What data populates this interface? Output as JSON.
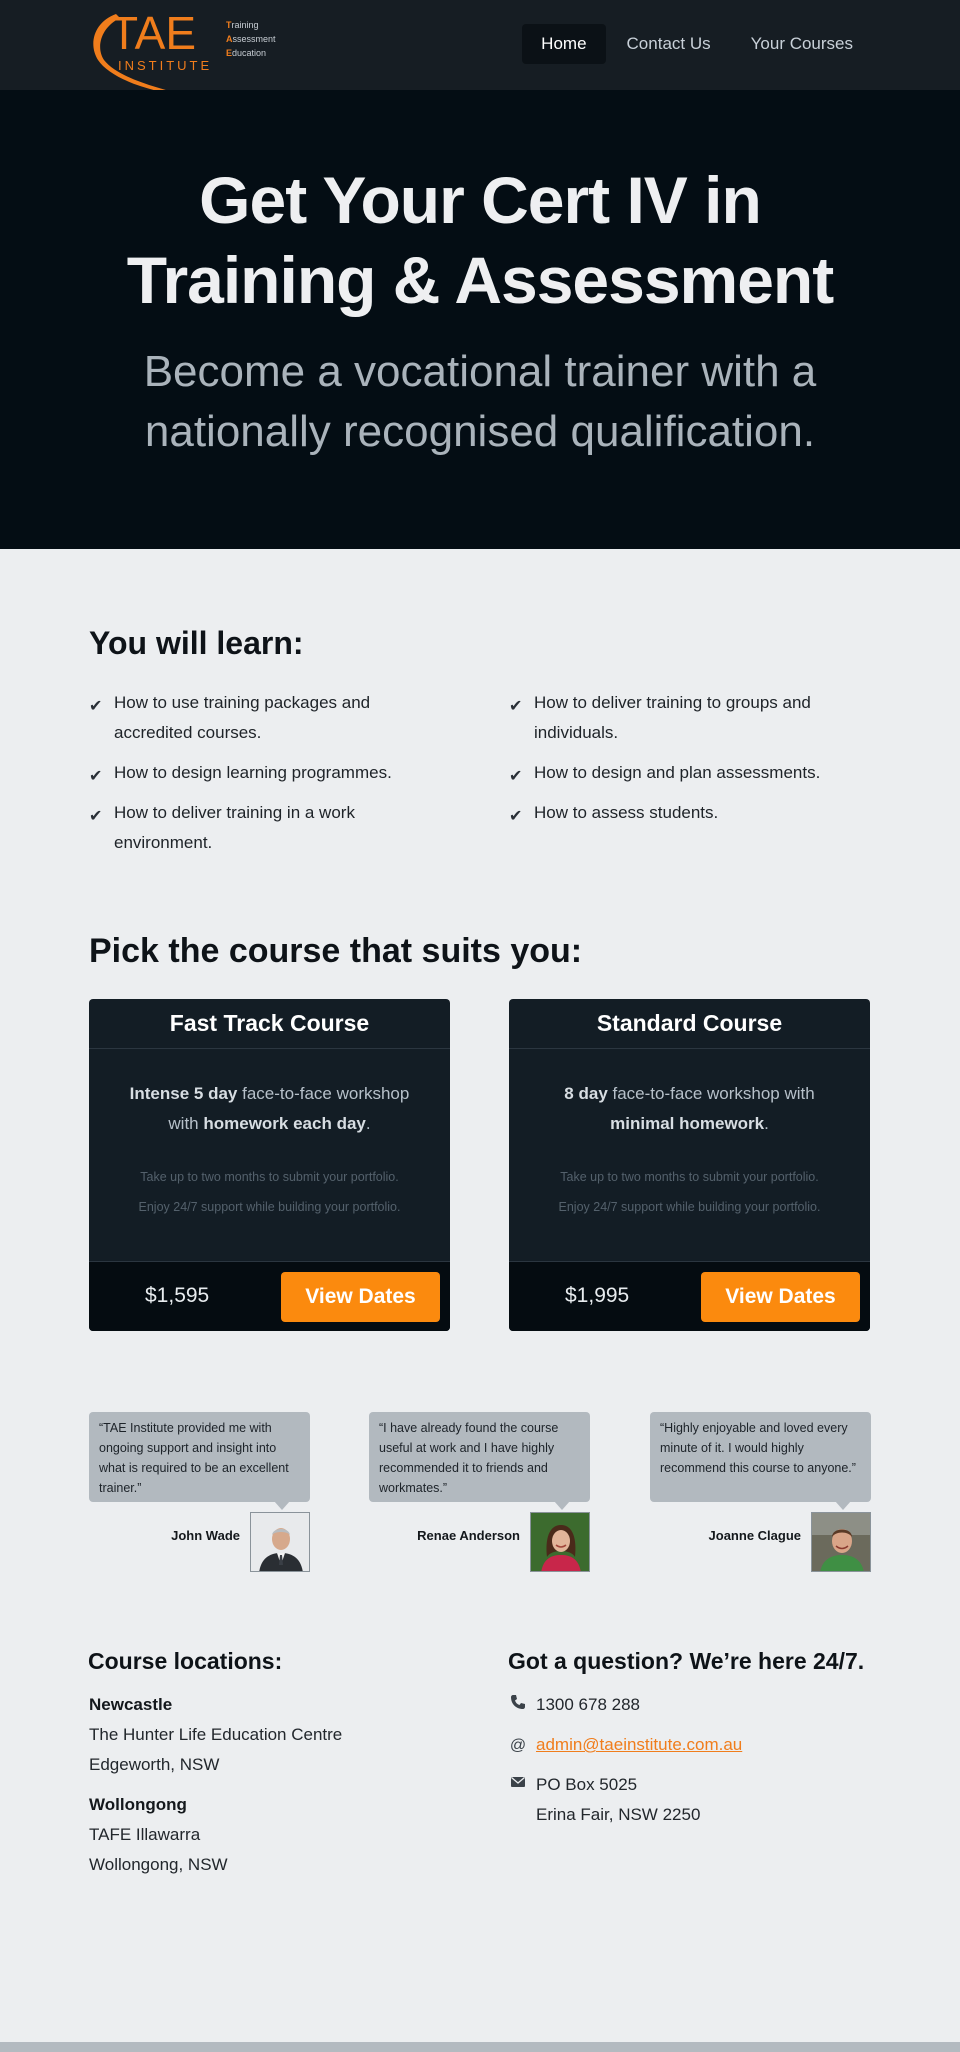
{
  "nav": {
    "logo": {
      "wordmark": "TAE",
      "subtitle": "INSTITUTE",
      "lines": [
        {
          "initial": "T",
          "rest": "raining"
        },
        {
          "initial": "A",
          "rest": "ssessment"
        },
        {
          "initial": "E",
          "rest": "ducation"
        }
      ]
    },
    "links": [
      {
        "label": "Home",
        "active": true
      },
      {
        "label": "Contact Us",
        "active": false
      },
      {
        "label": "Your Courses",
        "active": false
      }
    ]
  },
  "hero": {
    "title_line1": "Get Your Cert IV in",
    "title_line2": "Training & Assessment",
    "subtitle_line1": "Become a vocational trainer with a",
    "subtitle_line2": "nationally recognised qualification."
  },
  "learn": {
    "title": "You will learn:",
    "left": [
      "How to use training packages and accredited courses.",
      "How to design learning programmes.",
      "How to deliver training in a work environment."
    ],
    "right": [
      "How to deliver training to groups and individuals.",
      "How to design and plan assessments.",
      "How to assess students."
    ]
  },
  "courses": {
    "title": "Pick the course that suits you:",
    "cards": [
      {
        "name": "Fast Track Course",
        "desc_bold1": "Intense 5 day",
        "desc_mid": " face-to-face workshop with ",
        "desc_bold2": "homework each day",
        "desc_end": ".",
        "note1": "Take up to two months to submit your portfolio.",
        "note2": "Enjoy 24/7 support while building your portfolio.",
        "price": "$1,595",
        "button": "View Dates"
      },
      {
        "name": "Standard Course",
        "desc_bold1": "8 day",
        "desc_mid": " face-to-face workshop with ",
        "desc_bold2": "minimal homework",
        "desc_end": ".",
        "note1": "Take up to two months to submit your portfolio.",
        "note2": "Enjoy 24/7 support while building your portfolio.",
        "price": "$1,995",
        "button": "View Dates"
      }
    ]
  },
  "testimonials": [
    {
      "quote": "“TAE Institute provided me with ongoing support and insight into what is required to be an excellent trainer.”",
      "name": "John Wade"
    },
    {
      "quote": "“I have already found the course useful at work and I have highly recommended it to friends and workmates.”",
      "name": "Renae Anderson"
    },
    {
      "quote": "“Highly enjoyable and loved every minute of it. I would highly recommend this course to anyone.”",
      "name": "Joanne Clague"
    }
  ],
  "locations": {
    "title": "Course locations:",
    "items": [
      {
        "name": "Newcastle",
        "line1": "The Hunter Life Education Centre",
        "line2": "Edgeworth, NSW"
      },
      {
        "name": "Wollongong",
        "line1": "TAFE Illawarra",
        "line2": "Wollongong, NSW"
      }
    ]
  },
  "contact": {
    "title": "Got a question? We’re here 24/7.",
    "phone": "1300 678 288",
    "email": "admin@taeinstitute.com.au",
    "post_line1": "PO Box 5025",
    "post_line2": "Erina Fair, NSW 2250",
    "icons": {
      "phone": "phone-icon",
      "email": "at-icon",
      "post": "envelope-icon"
    }
  },
  "colors": {
    "accent": "#fb8a0e",
    "nav_bg": "#161d23",
    "hero_bg": "#040d14",
    "card_bg": "#131d25",
    "page_bg": "#eceef0"
  }
}
